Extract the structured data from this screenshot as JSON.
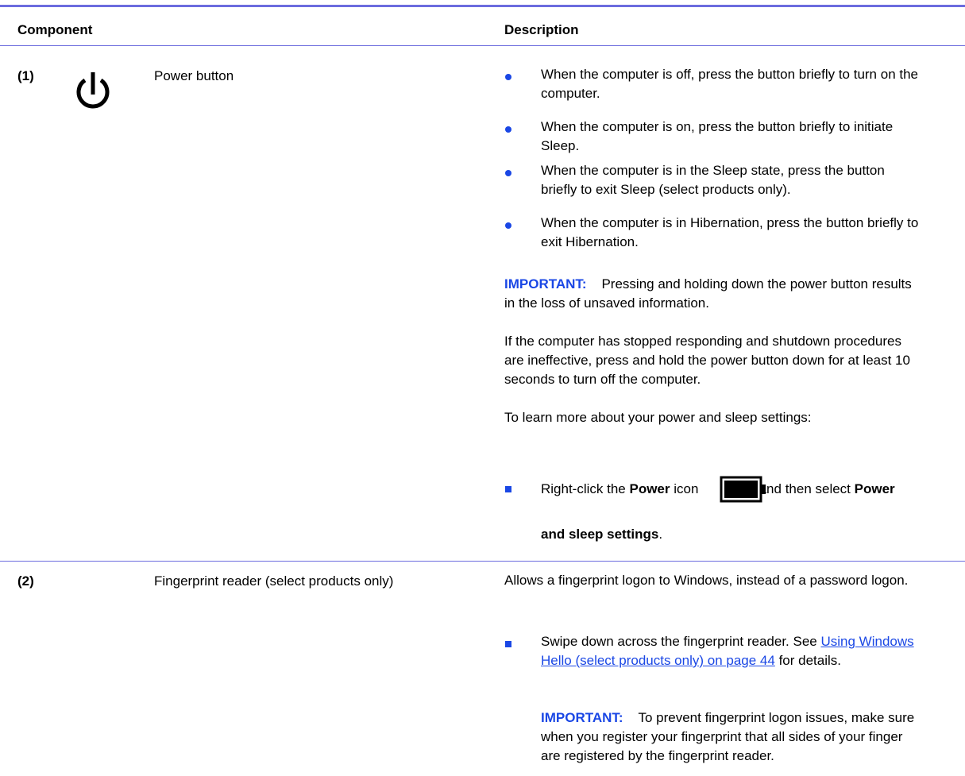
{
  "header": {
    "component": "Component",
    "description": "Description"
  },
  "rows": [
    {
      "number": "(1)",
      "icon": "power-icon",
      "name": "Power button",
      "bullets": [
        "When the computer is off, press the button briefly to turn on the computer.",
        "When the computer is on, press the button briefly to initiate Sleep.",
        "When the computer is in the Sleep state, press the button briefly to exit Sleep (select products only).",
        "When the computer is in Hibernation, press the button briefly to exit Hibernation."
      ],
      "important_label": "IMPORTANT:",
      "important_text": "Pressing and holding down the power button results in the loss of unsaved information.",
      "para1": "If the computer has stopped responding and shutdown procedures are ineffective, press and hold the power button down for at least 10 seconds to turn off the computer.",
      "para2": "To learn more about your power and sleep settings:",
      "sub": {
        "prefix": "Right-click the ",
        "bold1": "Power",
        "mid": " icon ",
        "icon": "battery-icon",
        "after_icon": ", and then select ",
        "bold2": "Power",
        "bold3": "and sleep settings",
        "end": "."
      }
    },
    {
      "number": "(2)",
      "name": "Fingerprint reader (select products only)",
      "desc": "Allows a fingerprint logon to Windows, instead of a password logon.",
      "sub": {
        "prefix": "Swipe down across the fingerprint reader. See ",
        "link": "Using Windows Hello (select products only) on page 44",
        "suffix": " for details."
      },
      "important_label": "IMPORTANT:",
      "important_text": "To prevent fingerprint logon issues, make sure when you register your fingerprint that all sides of your finger are registered by the fingerprint reader."
    }
  ],
  "colors": {
    "accent": "#1a47e5",
    "rule": "#6c6cde"
  }
}
